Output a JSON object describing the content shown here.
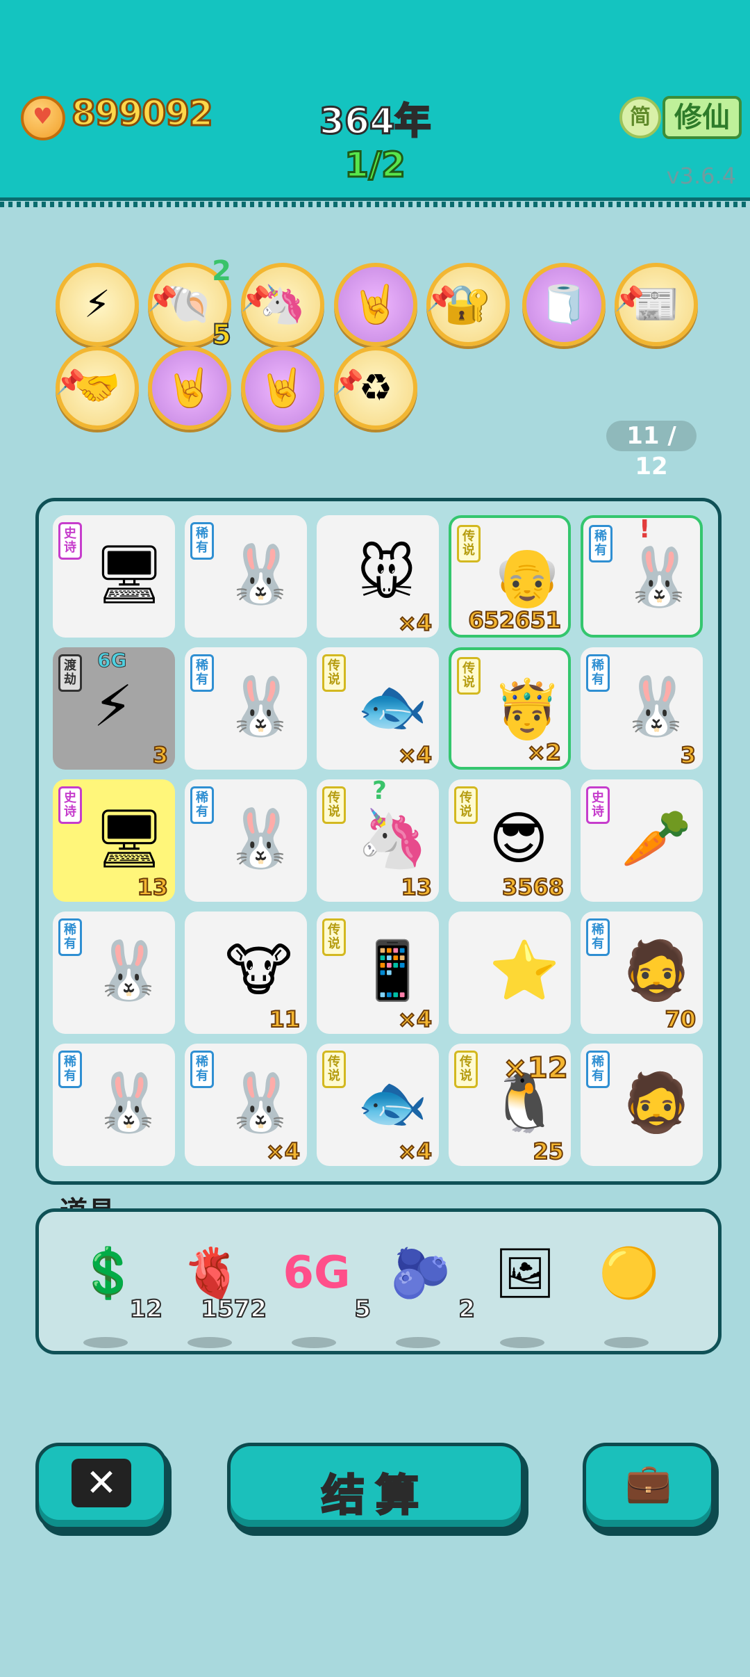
{
  "header": {
    "coins": "899092",
    "year": "364年",
    "progress": "1/2",
    "mode_small": "简",
    "mode": "修仙",
    "version": "v3.6.4"
  },
  "relics": [
    {
      "icon": "lightning-icon",
      "glyph": "⚡",
      "purple": false,
      "pinned": false
    },
    {
      "icon": "shell-icon",
      "glyph": "🐚",
      "purple": false,
      "pinned": true,
      "top_num": "2",
      "bottom_num": "5"
    },
    {
      "icon": "unicorn-icon",
      "glyph": "🦄",
      "purple": false,
      "pinned": true
    },
    {
      "icon": "rock-hand-icon",
      "glyph": "🤘",
      "purple": true,
      "pinned": false
    },
    {
      "icon": "safe-icon",
      "glyph": "🔐",
      "purple": false,
      "pinned": true
    },
    {
      "icon": "tissue-box-icon",
      "glyph": "🧻",
      "purple": true,
      "pinned": false
    },
    {
      "icon": "time-magazine-icon",
      "glyph": "📰",
      "purple": false,
      "pinned": true
    },
    {
      "icon": "handshake-icon",
      "glyph": "🤝",
      "purple": false,
      "pinned": true
    },
    {
      "icon": "rock-hand-icon",
      "glyph": "🤘",
      "purple": true,
      "pinned": false
    },
    {
      "icon": "rock-hand-icon",
      "glyph": "🤘",
      "purple": true,
      "pinned": false
    },
    {
      "icon": "recycle-icon",
      "glyph": "♻",
      "purple": false,
      "pinned": true
    }
  ],
  "relic_counter": "11 / 12",
  "board": {
    "cells": [
      {
        "tag": "史诗",
        "tag_type": "epic",
        "icon": "gpu-icon",
        "glyph": "🖥",
        "badge": ""
      },
      {
        "tag": "稀有",
        "tag_type": "rare",
        "icon": "rabbit-icon",
        "glyph": "🐰",
        "badge": ""
      },
      {
        "tag": "",
        "tag_type": "",
        "icon": "mouse-icon",
        "glyph": "🐭",
        "badge": "×4"
      },
      {
        "tag": "传说",
        "tag_type": "legend",
        "icon": "bald-man-icon",
        "glyph": "👴",
        "badge": "652651",
        "selected": true
      },
      {
        "tag": "稀有",
        "tag_type": "rare",
        "icon": "rabbit-icon",
        "glyph": "🐰",
        "badge": "",
        "selected": true,
        "alert": "!"
      },
      {
        "tag": "渡劫",
        "tag_type": "dj",
        "icon": "lightning-strike-icon",
        "glyph": "⚡",
        "badge": "3",
        "dark": true,
        "label_top": "6G"
      },
      {
        "tag": "稀有",
        "tag_type": "rare",
        "icon": "rabbit-icon",
        "glyph": "🐰",
        "badge": ""
      },
      {
        "tag": "传说",
        "tag_type": "legend",
        "icon": "koi-fish-icon",
        "glyph": "🐟",
        "badge": "×4"
      },
      {
        "tag": "传说",
        "tag_type": "legend",
        "icon": "king-icon",
        "glyph": "🤴",
        "badge": "×2",
        "selected": true
      },
      {
        "tag": "稀有",
        "tag_type": "rare",
        "icon": "rabbit-icon",
        "glyph": "🐰",
        "badge": "3"
      },
      {
        "tag": "史诗",
        "tag_type": "epic",
        "icon": "gpu-icon",
        "glyph": "🖥",
        "badge": "13",
        "yellow": true
      },
      {
        "tag": "稀有",
        "tag_type": "rare",
        "icon": "rabbit-icon",
        "glyph": "🐰",
        "badge": ""
      },
      {
        "tag": "传说",
        "tag_type": "legend",
        "icon": "unicorn-icon",
        "glyph": "🦄",
        "badge": "13",
        "alert": "?"
      },
      {
        "tag": "传说",
        "tag_type": "legend",
        "icon": "sunglasses-man-icon",
        "glyph": "😎",
        "badge": "3568"
      },
      {
        "tag": "史诗",
        "tag_type": "epic",
        "icon": "carrot-icon",
        "glyph": "🥕",
        "badge": ""
      },
      {
        "tag": "稀有",
        "tag_type": "rare",
        "icon": "rabbit-icon",
        "glyph": "🐰",
        "badge": ""
      },
      {
        "tag": "",
        "tag_type": "",
        "icon": "cow-icon",
        "glyph": "🐮",
        "badge": "11"
      },
      {
        "tag": "传说",
        "tag_type": "legend",
        "icon": "phone-icon",
        "glyph": "📱",
        "badge": "×4"
      },
      {
        "tag": "",
        "tag_type": "",
        "icon": "star-icon",
        "glyph": "⭐",
        "badge": ""
      },
      {
        "tag": "稀有",
        "tag_type": "rare",
        "icon": "hat-man-icon",
        "glyph": "🧔",
        "badge": "70"
      },
      {
        "tag": "稀有",
        "tag_type": "rare",
        "icon": "rabbit-icon",
        "glyph": "🐰",
        "badge": ""
      },
      {
        "tag": "稀有",
        "tag_type": "rare",
        "icon": "rabbit-icon",
        "glyph": "🐰",
        "badge": "×4"
      },
      {
        "tag": "传说",
        "tag_type": "legend",
        "icon": "koi-fish-icon",
        "glyph": "🐟",
        "badge": "×4"
      },
      {
        "tag": "传说",
        "tag_type": "legend",
        "icon": "penguin-icon",
        "glyph": "🐧",
        "badge": "25",
        "overlay": "×12"
      },
      {
        "tag": "稀有",
        "tag_type": "rare",
        "icon": "hat-man-icon",
        "glyph": "🧔",
        "badge": ""
      }
    ]
  },
  "tools": {
    "label": "道具",
    "items": [
      {
        "icon": "coin-icon",
        "glyph": "💲",
        "count": "12"
      },
      {
        "icon": "liver-icon",
        "glyph": "🫀",
        "count": "1572"
      },
      {
        "icon": "6g-icon",
        "glyph": "6G",
        "count": "5"
      },
      {
        "icon": "blueberry-icon",
        "glyph": "🫐",
        "count": "2"
      },
      {
        "icon": "frame-icon",
        "glyph": "🖼",
        "count": ""
      },
      {
        "icon": "gold-ball-icon",
        "glyph": "🟡",
        "count": ""
      }
    ]
  },
  "buttons": {
    "settle_label": "结算"
  }
}
